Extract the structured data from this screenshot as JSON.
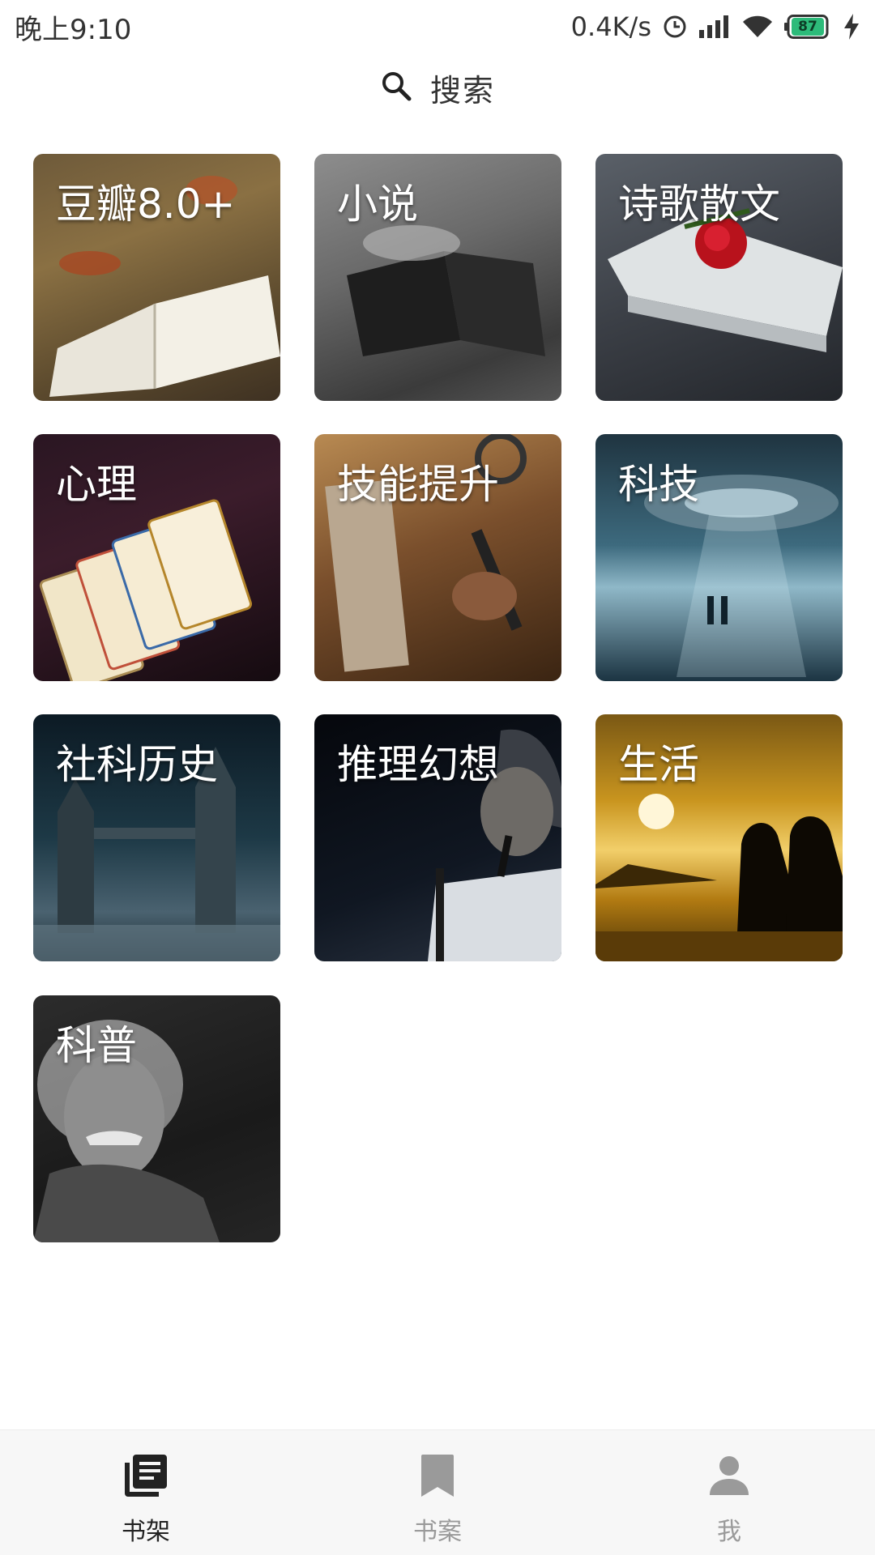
{
  "status_bar": {
    "time": "晚上9:10",
    "net_speed": "0.4K/s",
    "battery_level": "87",
    "icons": [
      "alarm-icon",
      "signal-icon",
      "wifi-icon",
      "battery-icon",
      "charging-icon"
    ]
  },
  "search": {
    "label": "搜索",
    "icon": "search-icon"
  },
  "categories": [
    {
      "label": "豆瓣8.0+"
    },
    {
      "label": "小说"
    },
    {
      "label": "诗歌散文"
    },
    {
      "label": "心理"
    },
    {
      "label": "技能提升"
    },
    {
      "label": "科技"
    },
    {
      "label": "社科历史"
    },
    {
      "label": "推理幻想"
    },
    {
      "label": "生活"
    },
    {
      "label": "科普"
    }
  ],
  "bottom_nav": {
    "items": [
      {
        "label": "书架",
        "icon": "library-books-icon",
        "active": true
      },
      {
        "label": "书案",
        "icon": "bookmark-icon",
        "active": false
      },
      {
        "label": "我",
        "icon": "person-icon",
        "active": false
      }
    ]
  },
  "colors": {
    "nav_active": "#222222",
    "nav_inactive": "#9a9a9a",
    "battery_fill": "#2dbb7a"
  }
}
